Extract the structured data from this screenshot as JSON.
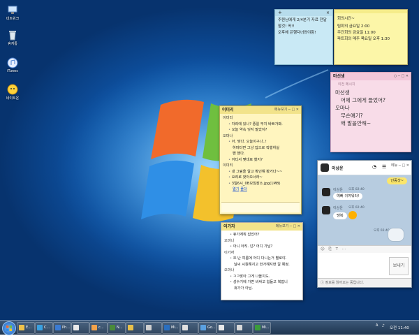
{
  "desktop": {
    "icons": [
      {
        "label": "네트워크",
        "icon": "network-icon"
      },
      {
        "label": "휴지통",
        "icon": "recycle-bin-icon"
      },
      {
        "label": "iTunes",
        "icon": "itunes-icon"
      },
      {
        "label": "네이트온",
        "icon": "nateon-icon"
      }
    ]
  },
  "notes": {
    "blue": {
      "lines": [
        "주원님에게 2/4분기 자료 전달할것! 꼭!!",
        "오후에 은행다녀와야함!"
      ]
    },
    "yellow_title": "회의시간~",
    "yellow": {
      "lines": [
        "팀회의 금요일 2:00",
        "주간회의 금요일 11:00",
        "파트회의 매주 목요일 오후 1:30"
      ]
    },
    "pink_title": "마선생",
    "pink": {
      "header": "이전 메시지",
      "speaker1": "마선생",
      "line1": "어제 그에게 들었어?",
      "speaker2": "오마나",
      "line2": "무슨얘기?",
      "line3": "왜 말을안해~"
    }
  },
  "chat1": {
    "title": "이미리",
    "controls": "메뉴보기 ─ □ ✕",
    "lines": [
      {
        "speaker": "이미리"
      },
      {
        "msg": "자리에 있나? 종일 무지 바쁘가봐."
      },
      {
        "msg": "오늘 약속 잊지 말았지?"
      },
      {
        "speaker": "오마나"
      },
      {
        "msg": "아. 맞다. 오늘이구나..!"
      },
      {
        "cont": "하마터면 그냥 집으로 직행하실"
      },
      {
        "cont": "뻔 했다."
      },
      {
        "msg": "어디서 몇대로 했지?"
      },
      {
        "speaker": "이미리"
      },
      {
        "msg": "내 그림을 알고 확인해 봤거다~~"
      },
      {
        "msg": "요리로 찾아오너라~"
      },
      {
        "msg": "3일6시_0B모임장소.jpg(1MB)"
      }
    ],
    "file_actions": [
      "열기",
      "폴더"
    ]
  },
  "chat2": {
    "title": "이가자",
    "controls": "메뉴보기 ─ □ ✕",
    "lines": [
      {
        "msg": "휴가계획 잡았어?"
      },
      {
        "speaker": "오마나"
      },
      {
        "msg": "아니 아직. 넌? 어디 가남?"
      },
      {
        "speaker": "이가자"
      },
      {
        "msg": "흐.난 여름에 어디 다니는거 별로야."
      },
      {
        "cont": "날씨 시원해지고 한가해지면 갈 예정."
      },
      {
        "speaker": "오마나"
      },
      {
        "msg": "ㅋㅋ맞아 그게 나을지도."
      },
      {
        "msg": "성수기에 가면 비싸고 힘들고 복잡니"
      },
      {
        "cont": "휴가가 아님."
      }
    ]
  },
  "kakao": {
    "name": "이상운",
    "controls": "메뉴 ─ □ ✕",
    "messages": [
      {
        "side": "right",
        "text": "인증샷~"
      },
      {
        "side": "left",
        "name": "이상운",
        "time": "오후 02:40",
        "text": "예뻐 귀여워라!"
      },
      {
        "side": "left",
        "name": "이상운",
        "time": "오후 02:40",
        "text": "땡복"
      },
      {
        "side": "right",
        "time": "오후 02:40",
        "text": ""
      }
    ],
    "send_label": "보내기",
    "status": "정보를 읽어오는 중입니다."
  },
  "taskbar": {
    "items": [
      "E...",
      "C...",
      "Ph...",
      "",
      "c...",
      "N...",
      "",
      "",
      "Mi...",
      "",
      "Go...",
      "",
      "",
      "Mi..."
    ],
    "lang": "A",
    "clock": "오전 11:40"
  },
  "colors": {
    "blue_note": "#c9e9f5",
    "yellow_note": "#fcf6a8",
    "pink_note": "#f8dce8",
    "chat_yellow": "#fff5bf",
    "chat_title": "#f2e38a",
    "kakao_yellow": "#fbe66b"
  }
}
